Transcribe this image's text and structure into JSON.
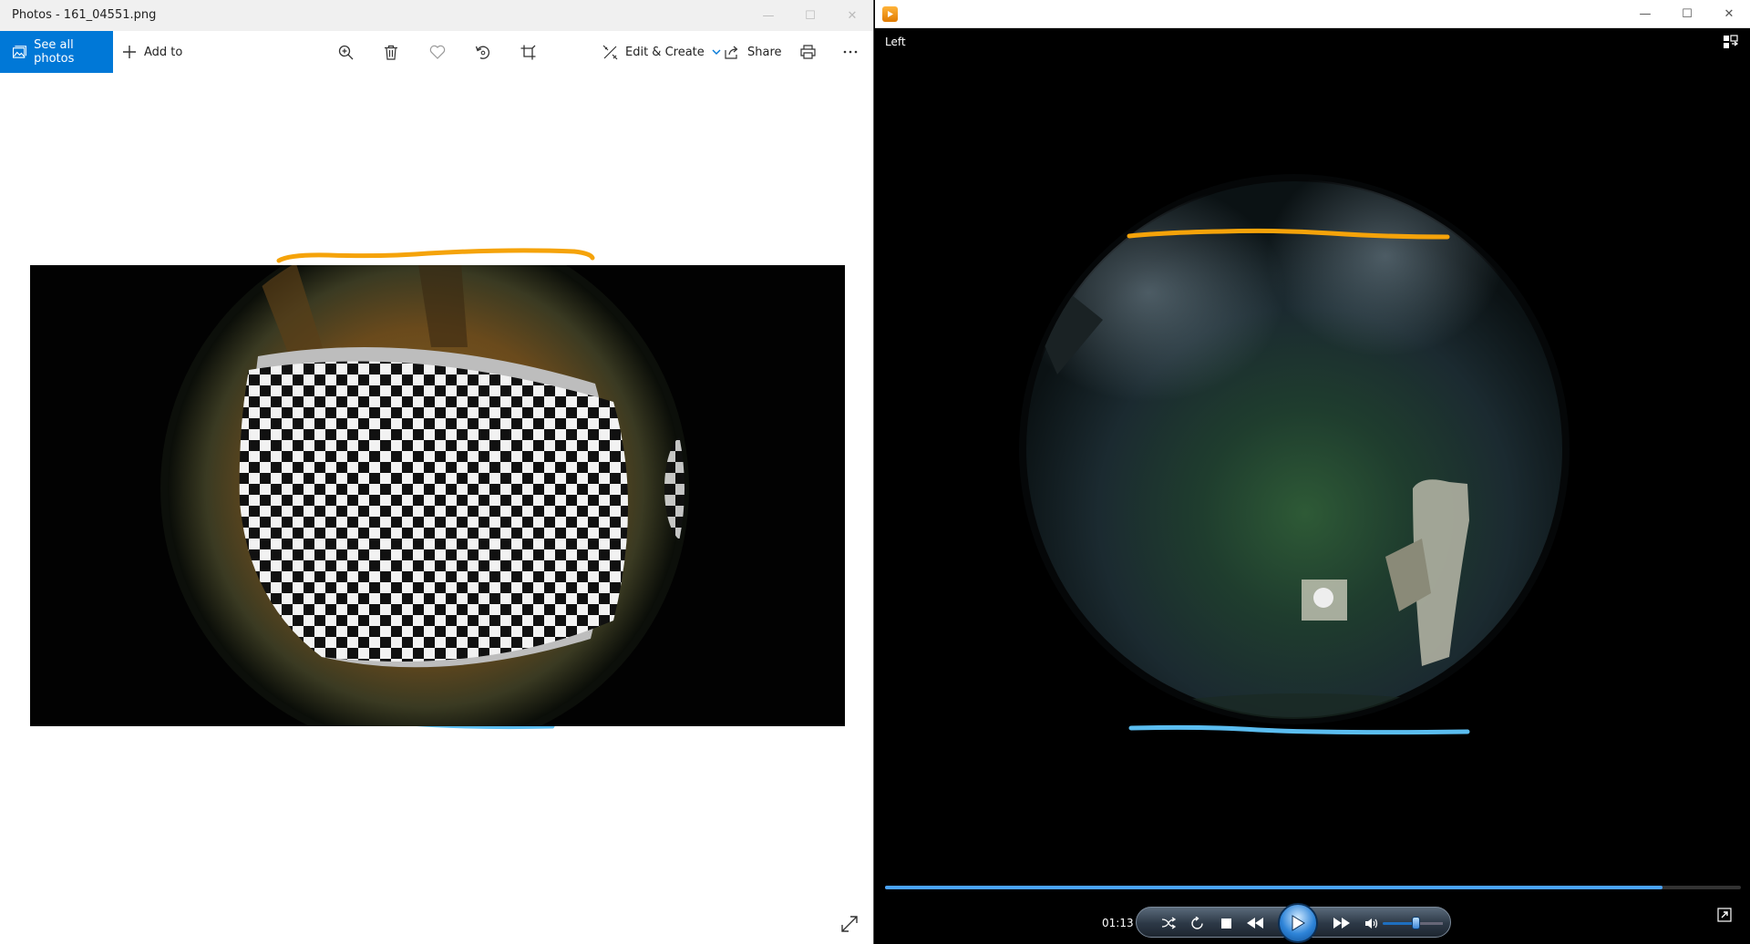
{
  "photos": {
    "title": "Photos - 161_04551.png",
    "toolbar": {
      "see_all_label": "See all photos",
      "add_to_label": "Add to",
      "edit_create_label": "Edit & Create",
      "share_label": "Share"
    }
  },
  "player": {
    "video_label": "Left",
    "time": "01:13",
    "progress_fraction": 0.908,
    "volume_fraction": 0.5
  },
  "colors": {
    "accent": "#0078d7",
    "annotation_top": "#f5a30a",
    "annotation_bottom": "#5bbdf0"
  }
}
